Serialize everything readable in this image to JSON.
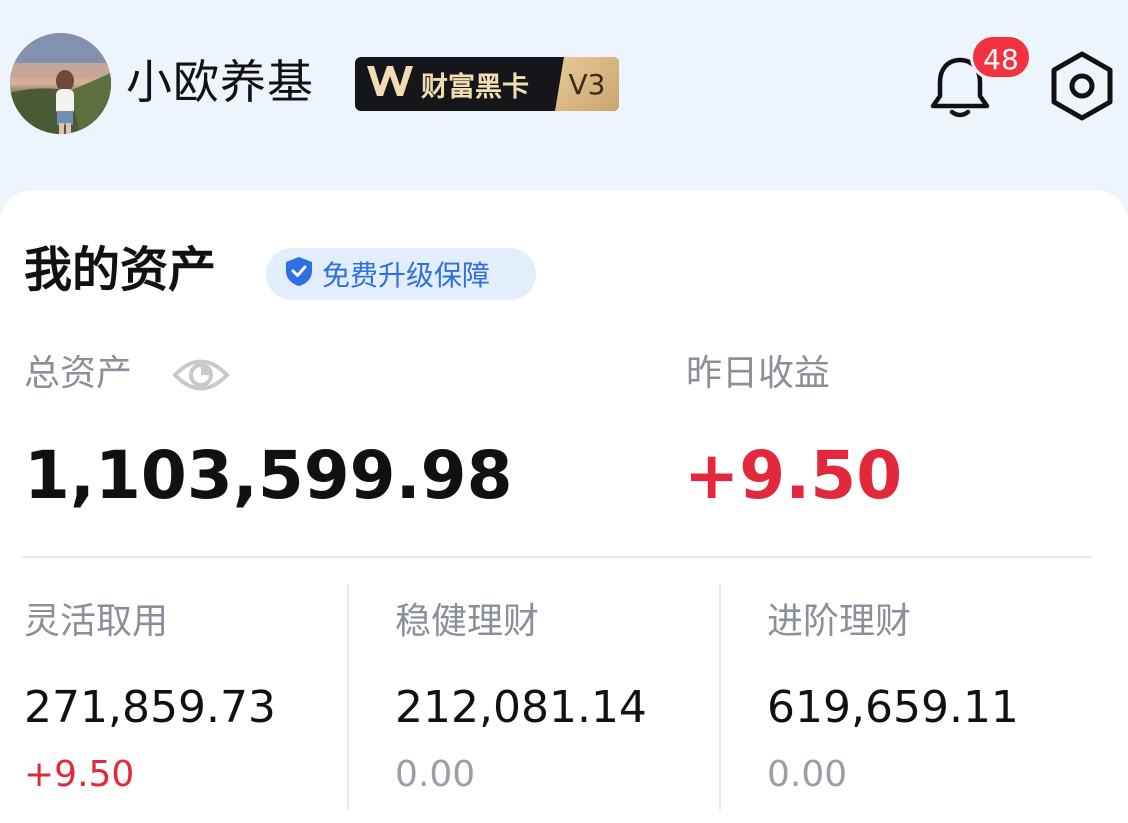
{
  "header": {
    "username": "小欧养基",
    "badge": {
      "text": "财富黑卡",
      "level": "V3"
    },
    "notification_count": "48",
    "icons": {
      "bell": "bell-icon",
      "settings": "settings-hexagon-icon"
    }
  },
  "assets": {
    "title": "我的资产",
    "upgrade_label": "免费升级保障",
    "total": {
      "label": "总资产",
      "value": "1,103,599.98"
    },
    "yesterday": {
      "label": "昨日收益",
      "value": "+9.50"
    },
    "categories": [
      {
        "label": "灵活取用",
        "value": "271,859.73",
        "change": "+9.50"
      },
      {
        "label": "稳健理财",
        "value": "212,081.14",
        "change": "0.00"
      },
      {
        "label": "进阶理财",
        "value": "619,659.11",
        "change": "0.00"
      }
    ]
  },
  "colors": {
    "background": "#eef4fc",
    "positive": "#e2283a",
    "accent_blue": "#2f6fe4",
    "badge_dark": "#15161a",
    "badge_gold": "#e8c99a",
    "notification": "#f2333f"
  }
}
